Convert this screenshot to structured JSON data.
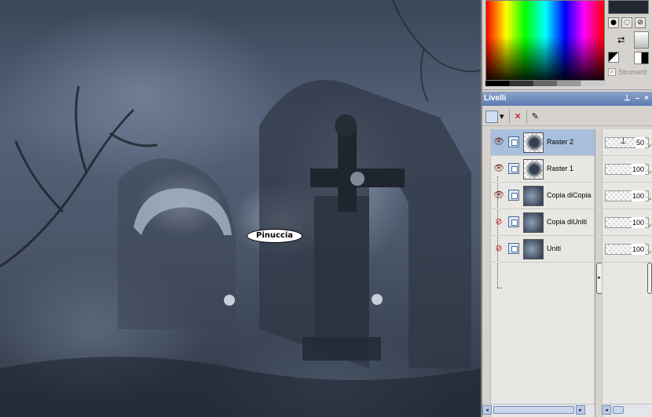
{
  "canvas": {
    "watermark_text": "Pinuccia"
  },
  "color_picker": {
    "foreground_color": "#232833",
    "tool_icons": [
      "round-brush-icon",
      "spray-brush-icon",
      "no-fill-icon"
    ],
    "tool_glyphs": [
      "●",
      "◌",
      "⊘"
    ],
    "swap_glyph": "⮂",
    "strumenti_label": "Strument",
    "strumenti_check": "✓"
  },
  "layers_panel": {
    "title": "Livelli",
    "title_icons": [
      "⊥",
      "–",
      "×"
    ],
    "toolbar": {
      "new_layer_dropdown": "▾",
      "delete_glyph": "✕",
      "edit_glyph": "✎"
    },
    "layers": [
      {
        "name": "Raster 2",
        "visible": true,
        "selected": true,
        "thumb": "mixed",
        "opacity": "50",
        "opacity_slider": "⊥"
      },
      {
        "name": "Raster 1",
        "visible": true,
        "selected": false,
        "thumb": "mixed",
        "opacity": "100"
      },
      {
        "name": "Copia diCopia",
        "visible": true,
        "selected": false,
        "thumb": "dark",
        "opacity": "100"
      },
      {
        "name": "Copia diUniti",
        "visible": false,
        "selected": false,
        "thumb": "dark",
        "opacity": "100"
      },
      {
        "name": "Uniti",
        "visible": false,
        "selected": false,
        "thumb": "dark",
        "opacity": "100"
      }
    ],
    "visible_glyph": "👁",
    "hidden_glyph": "⊘",
    "opacity_grip": "⌟",
    "splitter_glyph": "▸"
  },
  "scrollbars": {
    "left_arrow": "◂",
    "right_arrow": "▸"
  }
}
